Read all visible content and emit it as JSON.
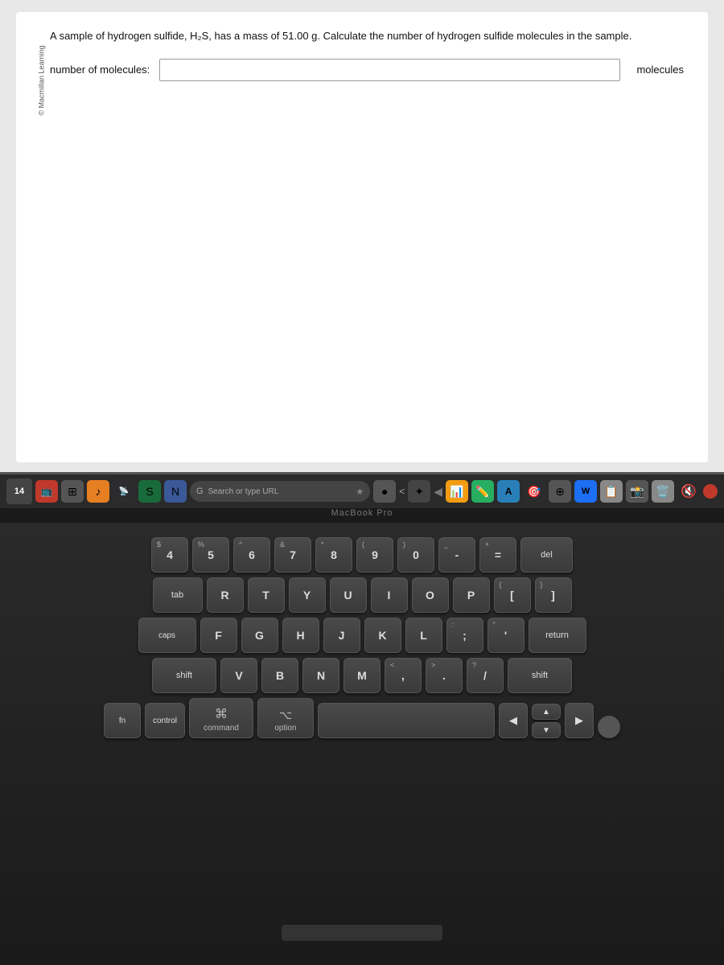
{
  "screen": {
    "copyright": "© Macmillan Learning",
    "question": "A sample of hydrogen sulfide, H₂S, has a mass of 51.00 g. Calculate the number of hydrogen sulfide molecules in the sample.",
    "answer_label": "number of molecules:",
    "answer_unit": "molecules"
  },
  "touchbar": {
    "date": "14",
    "search_placeholder": "Search or type URL",
    "macbook_label": "MacBook Pro",
    "icons": [
      "📺",
      "♪",
      "📡",
      "🔷",
      "N",
      "🌐",
      "📊",
      "✏️",
      "A",
      "🎯",
      "🌐",
      "W",
      "📋",
      "📸",
      "🗑️"
    ]
  },
  "keyboard": {
    "row1": [
      {
        "top": "$",
        "main": "4"
      },
      {
        "top": "%",
        "main": "5"
      },
      {
        "top": "^",
        "main": "6"
      },
      {
        "top": "&",
        "main": "7"
      },
      {
        "top": "*",
        "main": "8"
      },
      {
        "top": "(",
        "main": "9"
      },
      {
        "top": ")",
        "main": "0"
      },
      {
        "top": "_",
        "main": "-"
      },
      {
        "top": "+",
        "main": "="
      }
    ],
    "row2": [
      "R",
      "T",
      "Y",
      "U",
      "I",
      "O",
      "P",
      "{[",
      "}]"
    ],
    "row3": [
      "F",
      "G",
      "H",
      "J",
      "K",
      "L",
      ":;",
      "\"'"
    ],
    "row4": [
      "V",
      "B",
      "N",
      "M",
      "<,",
      ">.",
      "?/"
    ],
    "bottom": {
      "command_symbol": "⌘",
      "command_label": "command",
      "option_symbol": "⌥",
      "option_label": "option"
    }
  }
}
